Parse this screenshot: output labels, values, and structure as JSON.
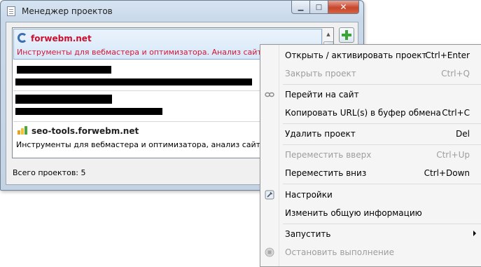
{
  "window": {
    "title": "Менеджер проектов",
    "minimize_glyph": "▁",
    "maximize_glyph": "□",
    "close_glyph": "✕"
  },
  "projects": [
    {
      "name": "forwebm.net",
      "description": "Инструменты для вебмастера и оптимизатора. Анализ сайта, провер",
      "icon": "swirl-logo-icon",
      "selected": true
    },
    {
      "name": "",
      "description": "",
      "icon": "redacted-icon",
      "redacted": true
    },
    {
      "name": "",
      "description": "",
      "icon": "redacted-icon",
      "redacted": true
    },
    {
      "name": "seo-tools.forwebm.net",
      "description": "Инструменты для вебмастера и оптимизатора, анализ сайта, провер",
      "icon": "bar-chart-icon"
    }
  ],
  "footer": {
    "total_label": "Всего проектов: 5"
  },
  "add_button": {
    "icon": "plus-icon"
  },
  "context_menu": {
    "items": [
      {
        "label": "Открыть / активировать проект",
        "shortcut": "Ctrl+Enter",
        "enabled": true,
        "bold": true
      },
      {
        "label": "Закрыть проект",
        "shortcut": "Ctrl+Q",
        "enabled": false
      },
      {
        "label": "Перейти на сайт",
        "shortcut": "",
        "enabled": true,
        "icon": "link-icon"
      },
      {
        "label": "Копировать URL(s) в буфер обмена",
        "shortcut": "Ctrl+C",
        "enabled": true
      },
      {
        "label": "Удалить проект",
        "shortcut": "Del",
        "enabled": true
      },
      {
        "label": "Переместить вверх",
        "shortcut": "Ctrl+Up",
        "enabled": false
      },
      {
        "label": "Переместить вниз",
        "shortcut": "Ctrl+Down",
        "enabled": true
      },
      {
        "label": "Настройки",
        "shortcut": "",
        "enabled": true,
        "icon": "settings-icon"
      },
      {
        "label": "Изменить общую информацию",
        "shortcut": "",
        "enabled": true
      },
      {
        "label": "Запустить",
        "shortcut": "",
        "enabled": true,
        "submenu": true
      },
      {
        "label": "Остановить выполнение",
        "shortcut": "",
        "enabled": false,
        "icon": "stop-icon"
      }
    ]
  },
  "colors": {
    "selected_text": "#c8102e",
    "accent_green": "#3aa536",
    "disabled_text": "#9d9d9d"
  }
}
